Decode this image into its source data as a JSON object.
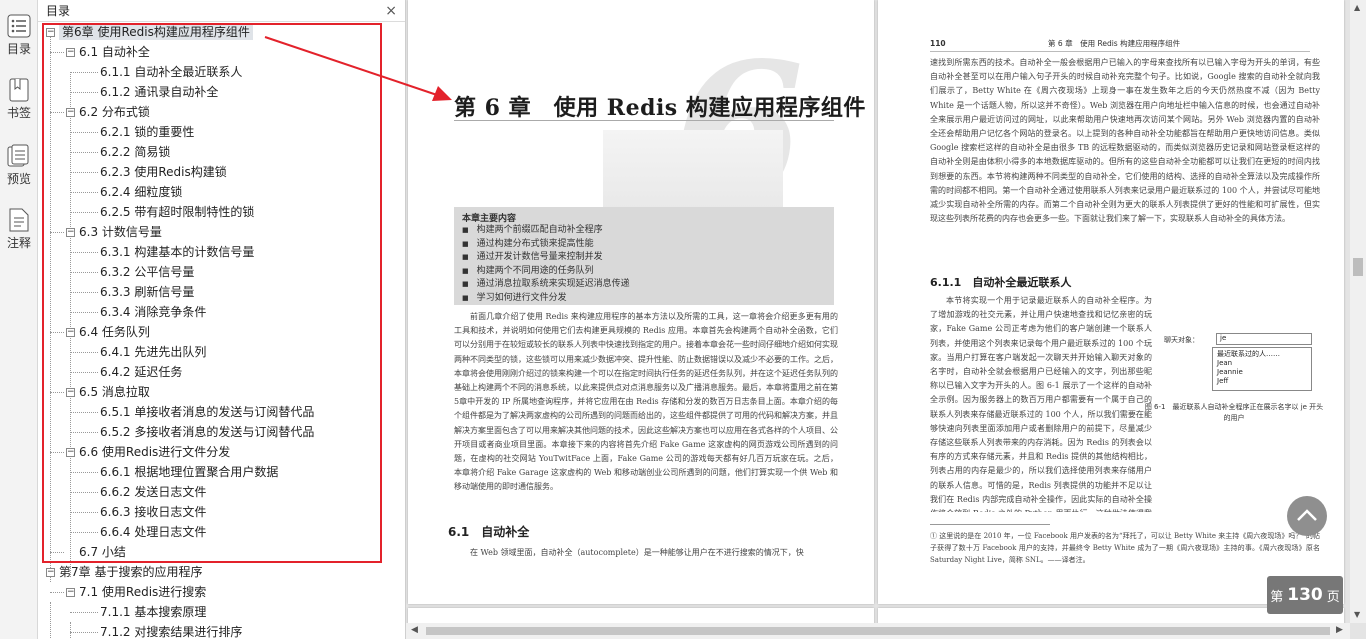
{
  "rail": {
    "items": [
      {
        "icon": "list-icon",
        "label": "目录"
      },
      {
        "icon": "bookmark-icon",
        "label": "书签"
      },
      {
        "icon": "preview-icon",
        "label": "预览"
      },
      {
        "icon": "note-icon",
        "label": "注释"
      }
    ]
  },
  "toc": {
    "title": "目录",
    "close": "×",
    "entries": [
      "第6章 使用Redis构建应用程序组件",
      "6.1 自动补全",
      "6.1.1 自动补全最近联系人",
      "6.1.2 通讯录自动补全",
      "6.2 分布式锁",
      "6.2.1 锁的重要性",
      "6.2.2 简易锁",
      "6.2.3 使用Redis构建锁",
      "6.2.4 细粒度锁",
      "6.2.5 带有超时限制特性的锁",
      "6.3 计数信号量",
      "6.3.1 构建基本的计数信号量",
      "6.3.2 公平信号量",
      "6.3.3 刷新信号量",
      "6.3.4 消除竞争条件",
      "6.4 任务队列",
      "6.4.1 先进先出队列",
      "6.4.2 延迟任务",
      "6.5 消息拉取",
      "6.5.1 单接收者消息的发送与订阅替代品",
      "6.5.2 多接收者消息的发送与订阅替代品",
      "6.6 使用Redis进行文件分发",
      "6.6.1 根据地理位置聚合用户数据",
      "6.6.2 发送日志文件",
      "6.6.3 接收日志文件",
      "6.6.4 处理日志文件",
      "6.7 小结",
      "第7章 基于搜索的应用程序",
      "7.1 使用Redis进行搜索",
      "7.1.1 基本搜索原理",
      "7.1.2 对搜索结果进行排序"
    ]
  },
  "page1": {
    "chapter_title": "第 6 章　使用 Redis 构建应用程序组件",
    "big_number": "6",
    "box_title": "本章主要内容",
    "box_items": [
      "构建两个前缀匹配自动补全程序",
      "通过构建分布式锁来提高性能",
      "通过开发计数信号量来控制并发",
      "构建两个不同用途的任务队列",
      "通过消息拉取系统来实现延迟消息传递",
      "学习如何进行文件分发"
    ],
    "body": "前面几章介绍了使用 Redis 来构建应用程序的基本方法以及所需的工具，这一章将会介绍更多更有用的工具和技术，并说明如何使用它们去构建更具规模的 Redis 应用。本章首先会构建两个自动补全函数，它们可以分别用于在较短或较长的联系人列表中快速找到指定的用户。接着本章会花一些时间仔细地介绍如何实现两种不同类型的锁，这些锁可以用来减少数据冲突、提升性能、防止数据错误以及减少不必要的工作。之后，本章将会使用刚刚介绍过的锁来构建一个可以在指定时间执行任务的延迟任务队列，并在这个延迟任务队列的基础上构建两个不同的消息系统，以此来提供点对点消息服务以及广播消息服务。最后，本章将重用之前在第5章中开发的 IP 所属地查询程序，并将它应用在由 Redis 存储和分发的数百万日志条目上面。本章介绍的每个组件都是为了解决两家虚构的公司所遇到的问题而给出的，这些组件都提供了可用的代码和解决方案，并且解决方案里面包含了可以用来解决其他问题的技术，因此这些解决方案也可以应用在各式各样的个人项目、公开项目或者商业项目里面。本章接下来的内容将首先介绍 Fake Game 这家虚构的网页游戏公司所遇到的问题，在虚构的社交网站 YouTwitFace 上面，Fake Game 公司的游戏每天都有好几百万玩家在玩。之后，本章将介绍 Fake Garage 这家虚构的 Web 和移动端创业公司所遇到的问题，他们打算实现一个供 Web 和移动端使用的即时通信服务。",
    "section_title": "6.1　自动补全",
    "section_body": "在 Web 领域里面，自动补全（autocomplete）是一种能够让用户在不进行搜索的情况下，快"
  },
  "page2": {
    "page_number": "110",
    "header": "第 6 章　使用 Redis 构建应用程序组件",
    "body_top": "速找到所需东西的技术。自动补全一般会根据用户已输入的字母来查找所有以已输入字母为开头的单词，有些自动补全甚至可以在用户输入句子开头的时候自动补充完整个句子。比如说，Google 搜索的自动补全就向我们展示了，Betty White 在《周六夜现场》上现身一事在发生数年之后的今天仍然热度不减（因为 Betty White 是一个话题人物，所以这并不奇怪）。Web 浏览器在用户向地址栏中输入信息的时候，也会通过自动补全来展示用户最近访问过的网址，以此来帮助用户快速地再次访问某个网站。另外 Web 浏览器内置的自动补全还会帮助用户记忆各个网站的登录名。以上提到的各种自动补全功能都旨在帮助用户更快地访问信息。类似 Google 搜索栏这样的自动补全是由很多 TB 的远程数据驱动的，而类似浏览器历史记录和网站登录框这样的自动补全则是由体积小得多的本地数据库驱动的。但所有的这些自动补全功能都可以让我们在更短的时间内找到想要的东西。本节将构建两种不同类型的自动补全，它们使用的结构、选择的自动补全算法以及完成操作所需的时间都不相同。第一个自动补全通过使用联系人列表来记录用户最近联系过的 100 个人，并尝试尽可能地减少实现自动补全所需的内存。而第二个自动补全则为更大的联系人列表提供了更好的性能和可扩展性，但实现这些列表所花费的内存也会更多一些。下面就让我们来了解一下，实现联系人自动补全的具体方法。",
    "subsection": "6.1.1　自动补全最近联系人",
    "body_mid": "本节将实现一个用于记录最近联系人的自动补全程序。为了增加游戏的社交元素，并让用户快速地查找和记忆亲密的玩家，Fake Game 公司正考虑为他们的客户端创建一个联系人列表，并使用这个列表来记录每个用户最近联系过的 100 个玩家。当用户打算在客户端发起一次聊天并开始输入聊天对象的名字时，自动补全就会根据用户已经输入的文字，列出那些昵称以已输入文字为开头的人。图 6-1 展示了一个这样的自动补全示例。因为服务器上的数百万用户都需要有一个属于自己的联系人列表来存储最近联系过的 100 个人，所以我们需要在能够快速向列表里面添加用户或者删除用户的前提下，尽量减少存储这些联系人列表带来的内存消耗。因为 Redis 的列表会以有序的方式来存储元素，并且和 Redis 提供的其他结构相比，列表占用的内存是最少的，所以我们选择使用列表来存储用户的联系人信息。可惜的是，Redis 列表提供的功能并不足以让我们在 Redis 内部完成自动补全操作，因此实际的自动补全操作将会放到 Redis 之外的 Python 里面执行，这种做法使得我们可以尽量减少 Redis 存储和更新用户最近联系人列表所需的内存数量，并将较为简单的过滤工作交给 Python 来执行。",
    "fig_label": "聊天对象：",
    "fig_input": "je",
    "fig_list_title": "最近联系过的人……",
    "fig_names": [
      "Jean",
      "Jeannie",
      "Jeff"
    ],
    "fig_caption": "图 6-1　最近联系人自动补全程序正在展示名字以 je 开头的用户",
    "footnote": "① 这里说的是在 2010 年，一位 Facebook 用户发表的名为“拜托了，可以让 Betty White 来主持《周六夜现场》吗？”的帖子获得了数十万 Facebook 用户的支持，并最终令 Betty White 成为了一期《周六夜现场》主持的事。《周六夜现场》原名 Saturday Night Live，简称 SNL。——译者注。"
  },
  "page_badge": {
    "prefix": "第",
    "number": "130",
    "suffix": "页"
  },
  "colors": {
    "highlight": "#e3222b",
    "selected_row": "#dfe3e8"
  }
}
